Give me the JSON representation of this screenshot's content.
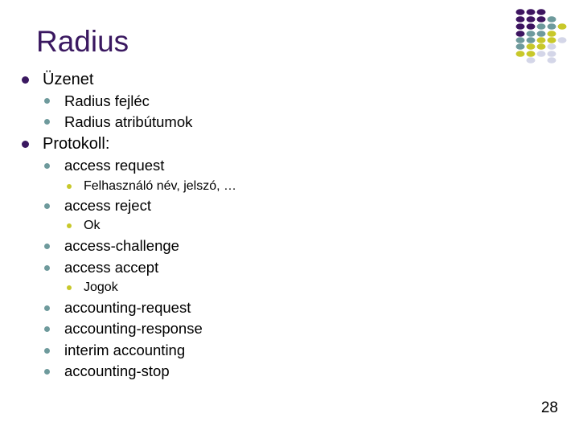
{
  "slide": {
    "title": "Radius",
    "page_number": "28",
    "colors": {
      "title": "#3a1860",
      "bullet_level1": "#3a1860",
      "bullet_level2": "#6e9a9c",
      "bullet_level3": "#c8c82a"
    },
    "decoration": {
      "name": "dot-grid-logo",
      "palette": {
        "P": "#3d1460",
        "T": "#6e9a9c",
        "Y": "#c8c82a",
        "L": "#d4d6e8"
      },
      "rows": [
        "PPP..",
        "PPPT.",
        "PPTTY",
        "PTTY.",
        "TTYYL",
        "TYYL.",
        "YYLL.",
        ".L.L."
      ]
    },
    "items": [
      {
        "level": 1,
        "text": "Üzenet"
      },
      {
        "level": 2,
        "text": "Radius fejléc"
      },
      {
        "level": 2,
        "text": "Radius atribútumok"
      },
      {
        "level": 1,
        "text": "Protokoll:"
      },
      {
        "level": 2,
        "text": "access request"
      },
      {
        "level": 3,
        "text": "Felhasználó név, jelszó, …"
      },
      {
        "level": 2,
        "text": "access reject"
      },
      {
        "level": 3,
        "text": "Ok"
      },
      {
        "level": 2,
        "text": "access-challenge"
      },
      {
        "level": 2,
        "text": "access accept"
      },
      {
        "level": 3,
        "text": "Jogok"
      },
      {
        "level": 2,
        "text": "accounting-request"
      },
      {
        "level": 2,
        "text": "accounting-response"
      },
      {
        "level": 2,
        "text": "interim accounting"
      },
      {
        "level": 2,
        "text": "accounting-stop"
      }
    ]
  }
}
